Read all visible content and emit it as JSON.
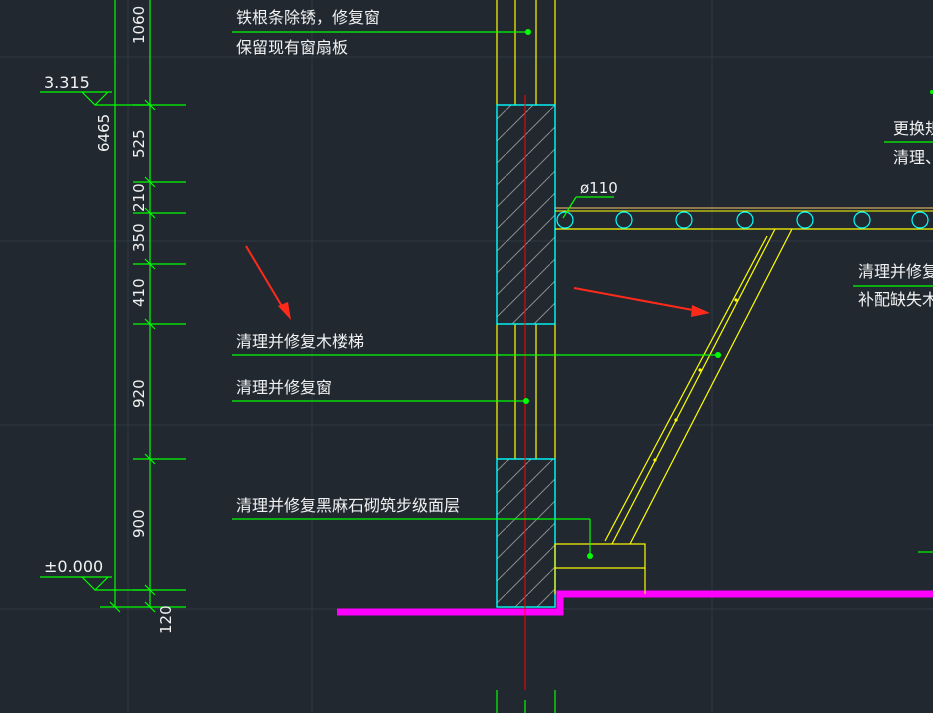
{
  "levels": {
    "upper": "3.315",
    "ground": "±0.000"
  },
  "dimensions": {
    "overall": "6465",
    "segments": [
      "1060",
      "525",
      "210",
      "350",
      "410",
      "920",
      "900",
      "120"
    ]
  },
  "notes": {
    "note_top_1": "铁根条除锈，修复窗",
    "note_top_2": "保留现有窗扇板",
    "note_stair": "清理并修复木楼梯",
    "note_window": "清理并修复窗",
    "note_step": "清理并修复黑麻石砌筑步级面层",
    "note_right_1": "更换规",
    "note_right_2": "清理、",
    "note_right_3": "清理并修复木",
    "note_right_4": "补配缺失木楼"
  },
  "pipe_label": "ø110",
  "colors": {
    "background": "#212830",
    "dimension": "#00ff00",
    "column_outline": "#00ffff",
    "stair_lines": "#ffff00",
    "ground_line": "#ff00ff",
    "centerline": "#ff0000",
    "arrow": "#ff2a1a",
    "text": "#f2f2f2"
  }
}
